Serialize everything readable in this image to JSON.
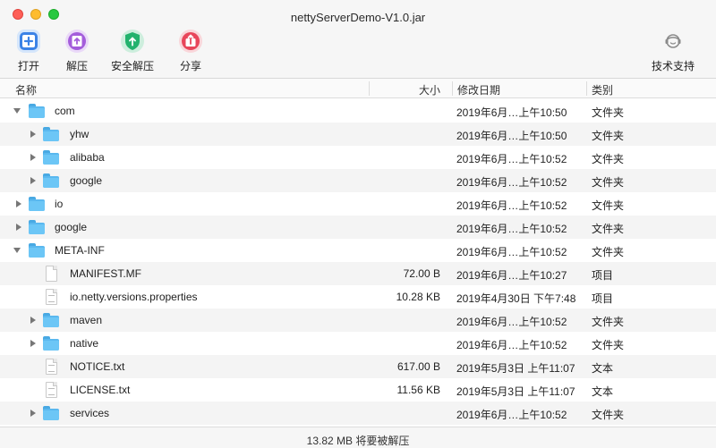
{
  "window": {
    "title": "nettyServerDemo-V1.0.jar"
  },
  "toolbar": {
    "open_label": "打开",
    "extract_label": "解压",
    "safe_extract_label": "安全解压",
    "share_label": "分享",
    "support_label": "技术支持"
  },
  "columns": {
    "name": "名称",
    "size": "大小",
    "modified": "修改日期",
    "kind": "类别"
  },
  "rows": [
    {
      "name": "com",
      "size": "",
      "date": "2019年6月…上午10:50",
      "kind": "文件夹"
    },
    {
      "name": "yhw",
      "size": "",
      "date": "2019年6月…上午10:50",
      "kind": "文件夹"
    },
    {
      "name": "alibaba",
      "size": "",
      "date": "2019年6月…上午10:52",
      "kind": "文件夹"
    },
    {
      "name": "google",
      "size": "",
      "date": "2019年6月…上午10:52",
      "kind": "文件夹"
    },
    {
      "name": "io",
      "size": "",
      "date": "2019年6月…上午10:52",
      "kind": "文件夹"
    },
    {
      "name": "google",
      "size": "",
      "date": "2019年6月…上午10:52",
      "kind": "文件夹"
    },
    {
      "name": "META-INF",
      "size": "",
      "date": "2019年6月…上午10:52",
      "kind": "文件夹"
    },
    {
      "name": "MANIFEST.MF",
      "size": "72.00 B",
      "date": "2019年6月…上午10:27",
      "kind": "项目"
    },
    {
      "name": "io.netty.versions.properties",
      "size": "10.28 KB",
      "date": "2019年4月30日 下午7:48",
      "kind": "项目"
    },
    {
      "name": "maven",
      "size": "",
      "date": "2019年6月…上午10:52",
      "kind": "文件夹"
    },
    {
      "name": "native",
      "size": "",
      "date": "2019年6月…上午10:52",
      "kind": "文件夹"
    },
    {
      "name": "NOTICE.txt",
      "size": "617.00 B",
      "date": "2019年5月3日 上午11:07",
      "kind": "文本"
    },
    {
      "name": "LICENSE.txt",
      "size": "11.56 KB",
      "date": "2019年5月3日 上午11:07",
      "kind": "文本"
    },
    {
      "name": "services",
      "size": "",
      "date": "2019年6月…上午10:52",
      "kind": "文件夹"
    }
  ],
  "status": {
    "text": "13.82 MB 将要被解压"
  },
  "colors": {
    "open": "#3b82e6",
    "extract": "#a45ddb",
    "safe_extract": "#23b26d",
    "share": "#e8455a"
  }
}
